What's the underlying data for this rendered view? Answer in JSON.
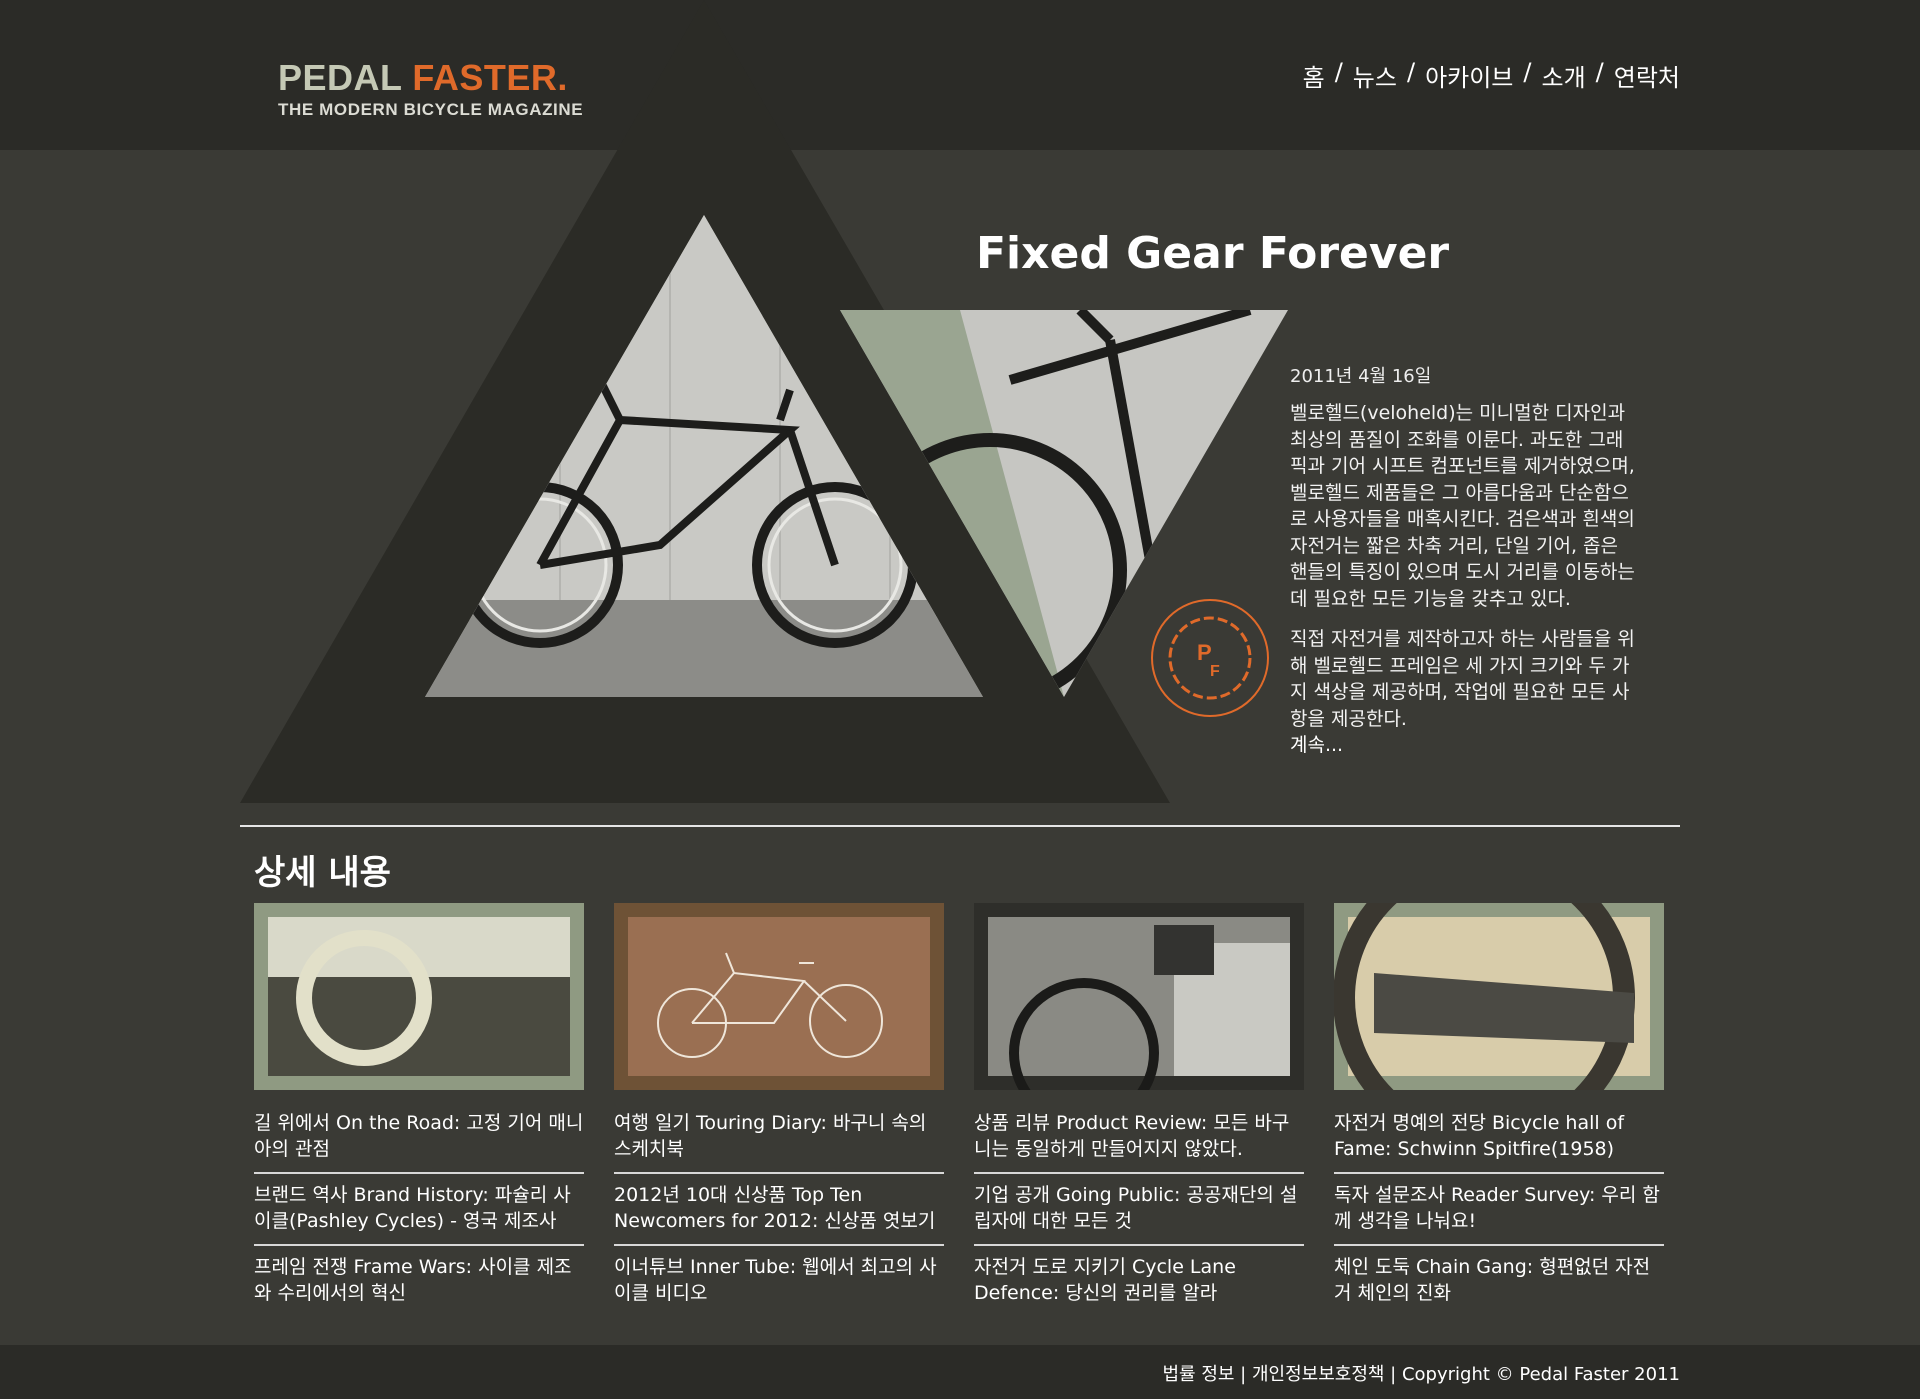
{
  "logo": {
    "word1": "PEDAL",
    "word2": "FASTER.",
    "tagline": "THE MODERN BICYCLE MAGAZINE"
  },
  "nav": [
    {
      "label": "홈"
    },
    {
      "label": "뉴스"
    },
    {
      "label": "아카이브"
    },
    {
      "label": "소개"
    },
    {
      "label": "연락처"
    }
  ],
  "nav_separator": "/",
  "hero": {
    "title": "Fixed Gear Forever",
    "date": "2011년 4월 16일",
    "para1": "벨로헬드(veloheld)는 미니멀한 디자인과 최상의 품질이 조화를 이룬다. 과도한 그래픽과 기어 시프트 컴포넌트를 제거하였으며, 벨로헬드 제품들은 그 아름다움과 단순함으로 사용자들을 매혹시킨다. 검은색과 흰색의 자전거는 짧은 차축 거리, 단일 기어, 좁은 핸들의 특징이 있으며 도시 거리를 이동하는 데 필요한 모든 기능을 갖추고 있다.",
    "para2": "직접 자전거를 제작하고자 하는 사람들을 위해 벨로헬드 프레임은 세 가지 크기와 두 가지 색상을 제공하며, 작업에 필요한 모든 사항을 제공한다.",
    "more": "계속...",
    "badge_text": "PF"
  },
  "section_title": "상세 내용",
  "columns": [
    {
      "links": [
        "길 위에서 On the Road: 고정 기어 매니아의 관점",
        "브랜드 역사 Brand History: 파슐리 사이클(Pashley Cycles) - 영국 제조사",
        "프레임 전쟁 Frame Wars: 사이클 제조와 수리에서의 혁신"
      ]
    },
    {
      "links": [
        "여행 일기 Touring Diary: 바구니 속의 스케치북",
        "2012년 10대 신상품 Top Ten Newcomers for 2012: 신상품 엿보기",
        "이너튜브 Inner Tube: 웹에서 최고의 사이클 비디오"
      ]
    },
    {
      "links": [
        "상품 리뷰 Product Review: 모든 바구니는 동일하게 만들어지지 않았다.",
        "기업 공개 Going Public: 공공재단의 설립자에 대한 모든 것",
        "자전거 도로 지키기 Cycle Lane Defence: 당신의 권리를 알라"
      ]
    },
    {
      "links": [
        "자전거 명예의 전당 Bicycle hall of Fame: Schwinn Spitfire(1958)",
        "독자 설문조사 Reader Survey: 우리 함께 생각을 나눠요!",
        "체인 도둑 Chain Gang: 형편없던 자전거 체인의 진화"
      ]
    }
  ],
  "footer": "법률 정보 | 개인정보보호정책 | Copyright © Pedal Faster 2011",
  "colors": {
    "accent": "#e06a2a",
    "logo_gray": "#c5c9b5",
    "sage": "#9aa591"
  }
}
